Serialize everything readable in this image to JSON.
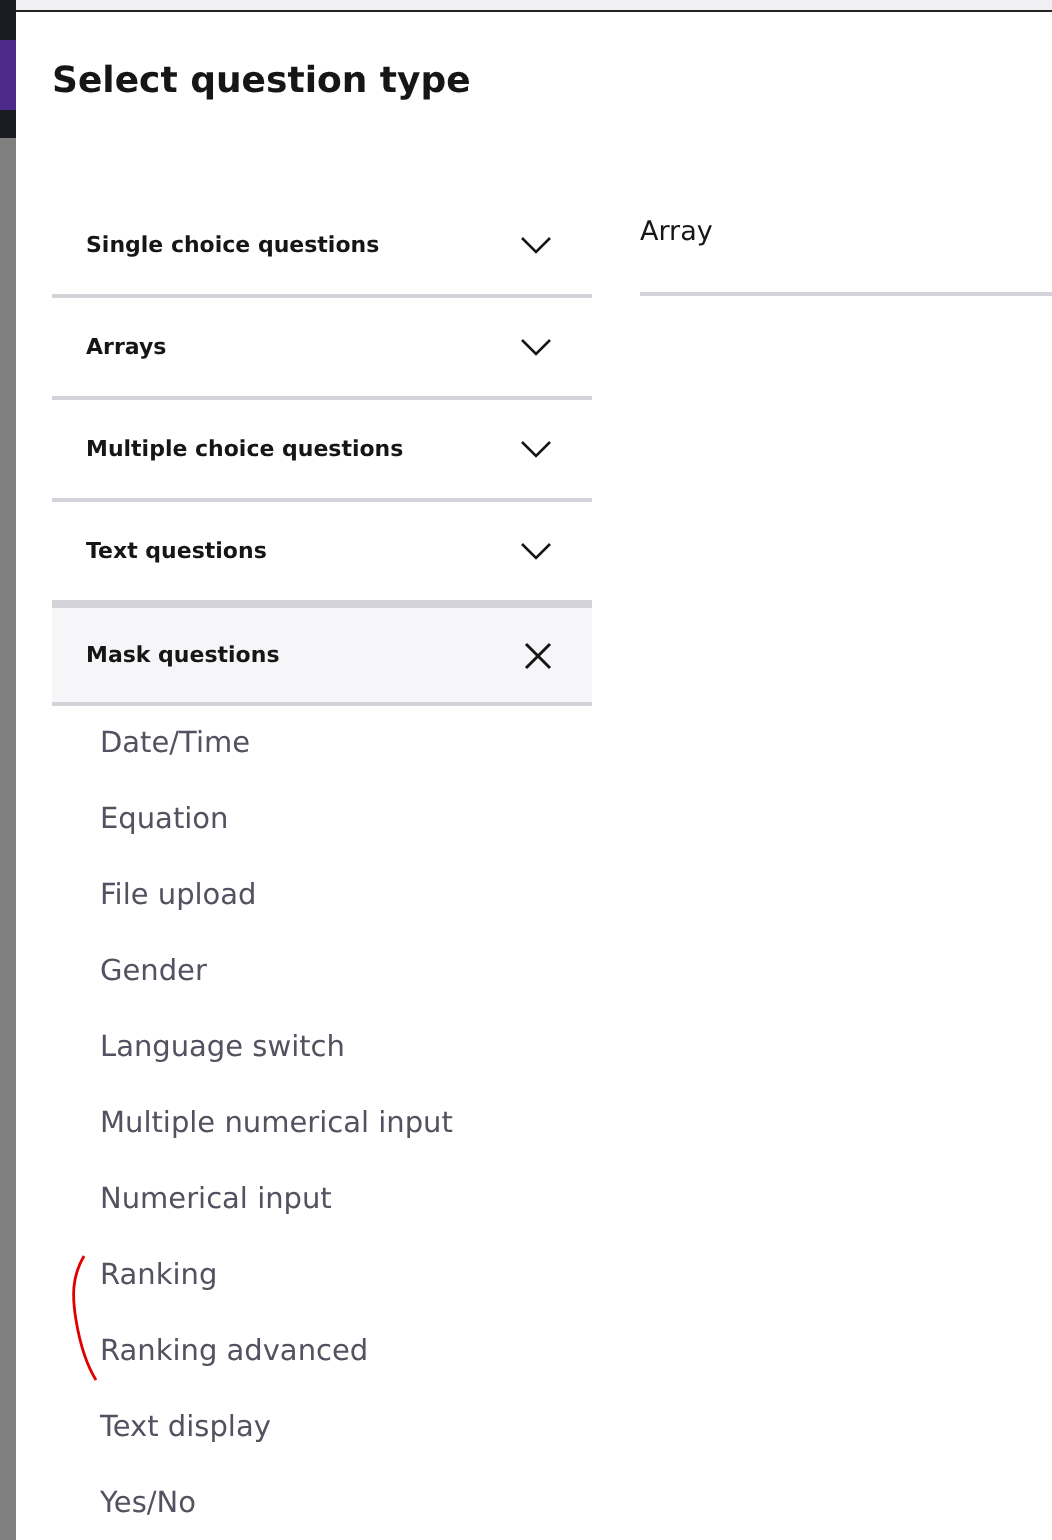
{
  "dialog": {
    "title": "Select question type"
  },
  "categories": [
    {
      "label": "Single choice questions",
      "expanded": false
    },
    {
      "label": "Arrays",
      "expanded": false
    },
    {
      "label": "Multiple choice questions",
      "expanded": false
    },
    {
      "label": "Text questions",
      "expanded": false
    },
    {
      "label": "Mask questions",
      "expanded": true,
      "items": [
        "Date/Time",
        "Equation",
        "File upload",
        "Gender",
        "Language switch",
        "Multiple numerical input",
        "Numerical input",
        "Ranking",
        "Ranking advanced",
        "Text display",
        "Yes/No"
      ]
    }
  ],
  "preview": {
    "title": "Array"
  }
}
